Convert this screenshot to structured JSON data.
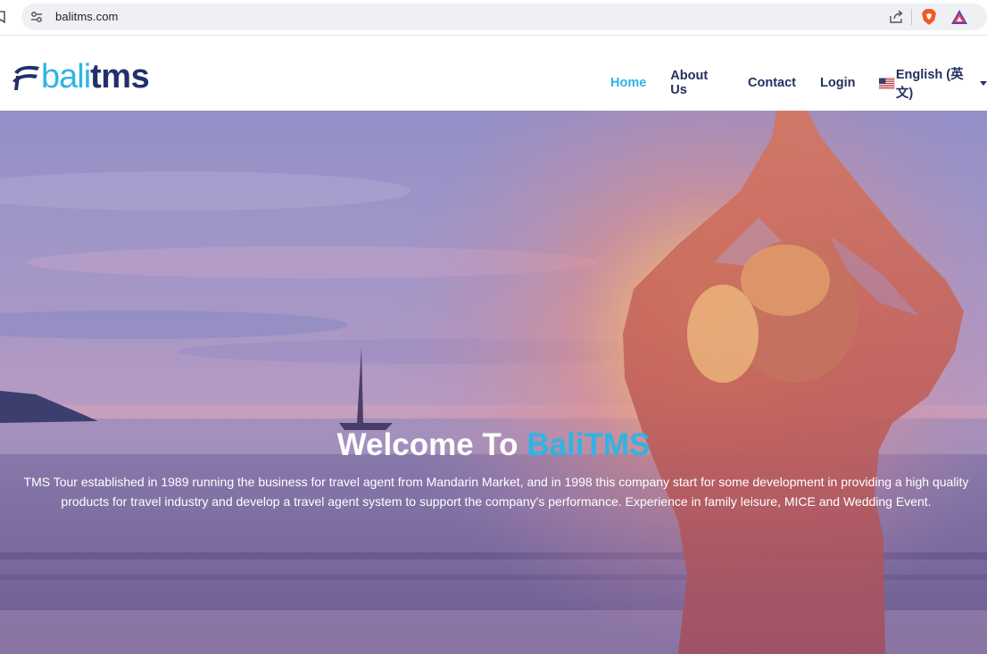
{
  "browser": {
    "url": "balitms.com"
  },
  "site": {
    "logo": {
      "part1": "bali",
      "part2": "tms"
    },
    "nav": [
      {
        "label": "Home",
        "active": true
      },
      {
        "label": "About Us",
        "active": false
      },
      {
        "label": "Contact",
        "active": false
      },
      {
        "label": "Login",
        "active": false
      }
    ],
    "language": "English (英文)"
  },
  "hero": {
    "title_prefix": "Welcome To ",
    "title_accent": "BaliTMS",
    "description": "TMS Tour established in 1989 running the business for travel agent from Mandarin Market, and in 1998 this company start for some development in providing a high quality products for travel industry and develop a travel agent system to support the company's performance. Experience in family leisure, MICE and Wedding Event."
  },
  "colors": {
    "accent": "#2fb4e4",
    "navy": "#24305e"
  }
}
